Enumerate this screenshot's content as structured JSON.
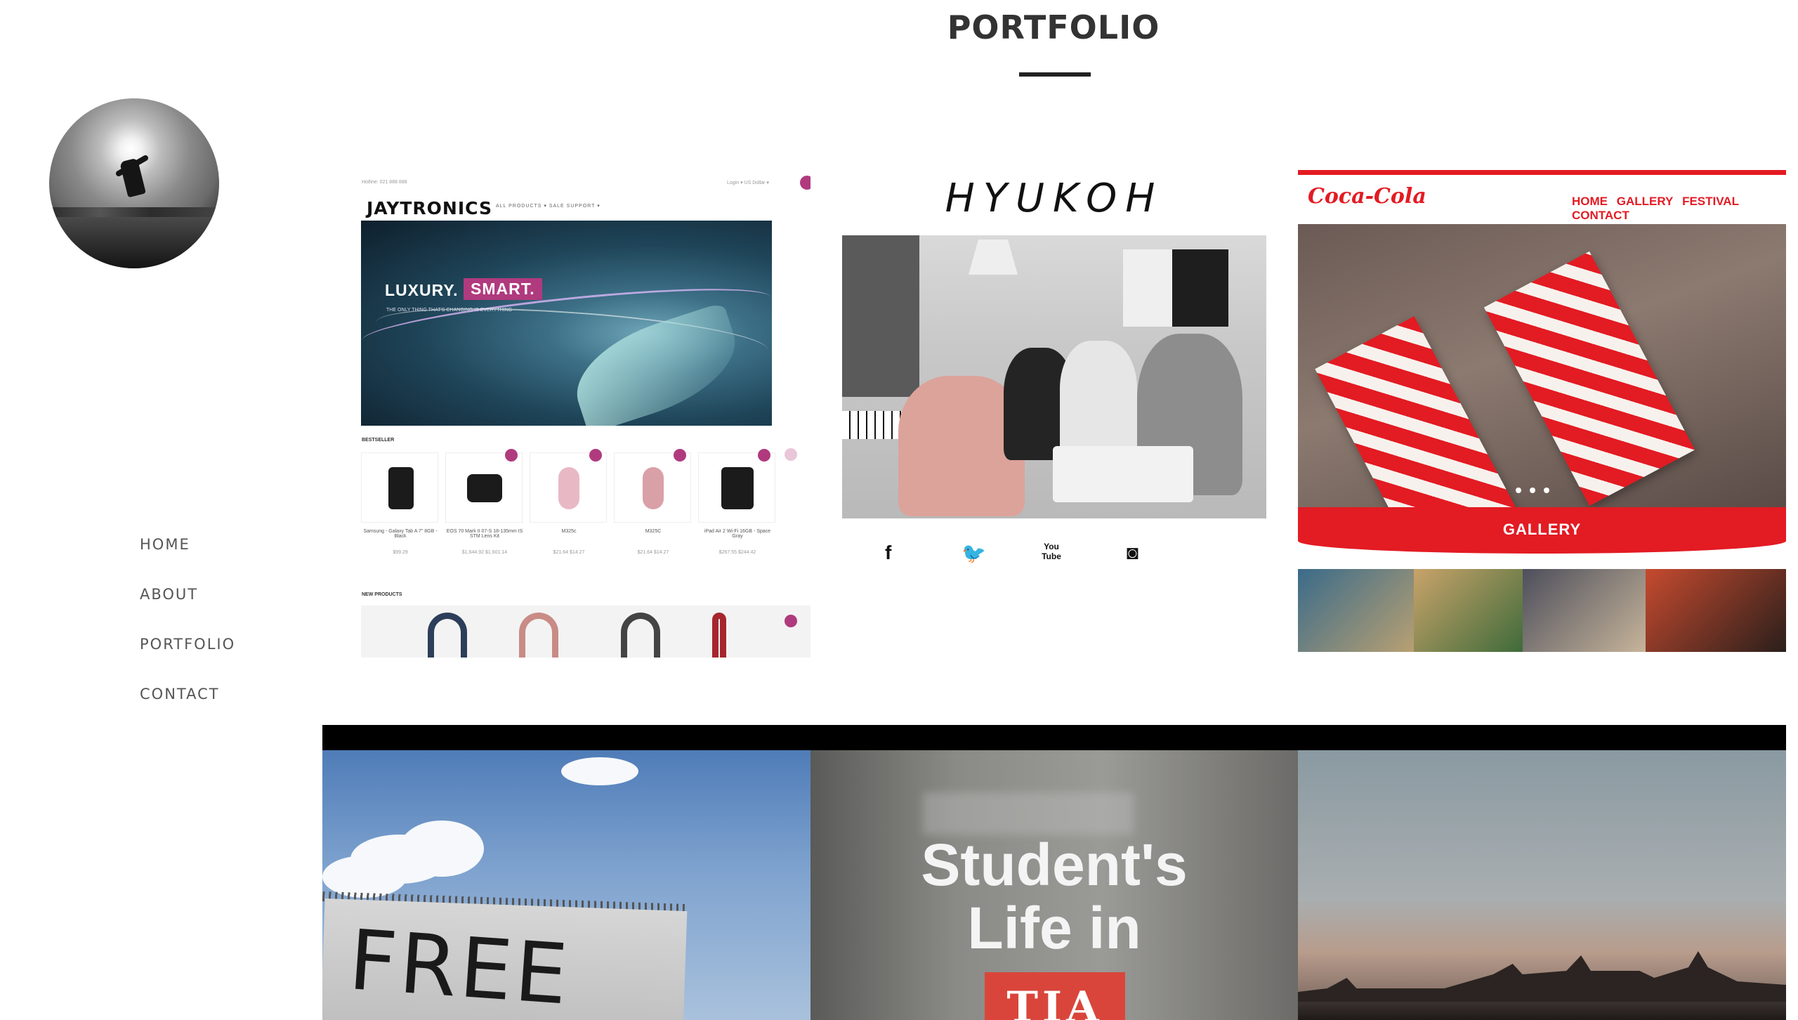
{
  "page": {
    "title": "PORTFOLIO"
  },
  "sidebar": {
    "nav": [
      {
        "label": "HOME"
      },
      {
        "label": "ABOUT"
      },
      {
        "label": "PORTFOLIO"
      },
      {
        "label": "CONTACT"
      }
    ]
  },
  "portfolio": {
    "jaytronics": {
      "hotline": "Hotline: 021 888 888",
      "login": "Login ▾   US Dollar ▾",
      "logo": "JAYTRONICS",
      "menu": "ALL PRODUCTS ▾     SALE     SUPPORT ▾",
      "headline1": "LUXURY.",
      "headline2": "SMART.",
      "tagline": "THE ONLY THING THAT'S CHANGING IS EVERYTHING",
      "bestseller_label": "BESTSELLER",
      "new_products_label": "NEW PRODUCTS",
      "products": [
        {
          "name": "Samsung - Galaxy Tab A 7\" 8GB - Black",
          "price": "$99.29"
        },
        {
          "name": "EOS 70 Mark II 07-S 18-135mm IS STM Lens Kit",
          "price": "$1,644.92 $1,601.14"
        },
        {
          "name": "M325c",
          "price": "$21.64 $14.27"
        },
        {
          "name": "M325C",
          "price": "$21.64 $14.27"
        },
        {
          "name": "iPad Air 2 Wi-Fi 16GB - Space Gray",
          "price": "$267.55 $244.42"
        }
      ]
    },
    "hyukoh": {
      "brand": "HYUKOH",
      "socials": [
        "f",
        "🐦",
        "You Tube",
        "◙"
      ]
    },
    "cocacola": {
      "logo": "Coca-Cola",
      "nav": [
        "HOME",
        "GALLERY",
        "FESTIVAL",
        "CONTACT"
      ],
      "gallery_label": "GALLERY"
    },
    "free": {
      "text": "FREE"
    },
    "students_life": {
      "line1": "Student's",
      "line2": "Life in",
      "badge": "TIA"
    }
  },
  "colors": {
    "accent_magenta": "#b03a7e",
    "coke_red": "#e31b23",
    "nav_text": "#555555"
  }
}
